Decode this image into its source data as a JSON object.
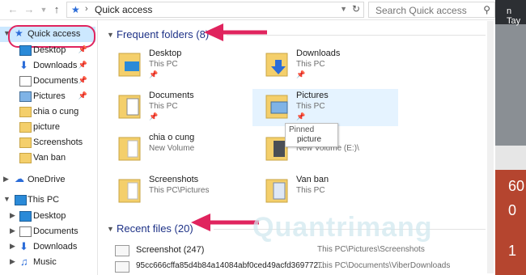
{
  "address": {
    "path": "Quick access",
    "search_placeholder": "Search Quick access"
  },
  "sidebar": {
    "items": [
      {
        "label": "Quick access",
        "icon": "star-icon"
      },
      {
        "label": "Desktop",
        "icon": "desktop-icon",
        "pinned": true
      },
      {
        "label": "Downloads",
        "icon": "download-icon",
        "pinned": true
      },
      {
        "label": "Documents",
        "icon": "documents-icon",
        "pinned": true
      },
      {
        "label": "Pictures",
        "icon": "pictures-icon",
        "pinned": true
      },
      {
        "label": "chia o cung",
        "icon": "folder-icon"
      },
      {
        "label": "picture",
        "icon": "folder-icon"
      },
      {
        "label": "Screenshots",
        "icon": "folder-icon"
      },
      {
        "label": "Van ban",
        "icon": "folder-icon"
      },
      {
        "label": "OneDrive",
        "icon": "cloud-icon"
      },
      {
        "label": "This PC",
        "icon": "computer-icon"
      },
      {
        "label": "Desktop",
        "icon": "desktop-icon"
      },
      {
        "label": "Documents",
        "icon": "documents-icon"
      },
      {
        "label": "Downloads",
        "icon": "download-icon"
      },
      {
        "label": "Music",
        "icon": "music-icon"
      }
    ]
  },
  "frequent": {
    "title": "Frequent folders (8)",
    "folders": [
      {
        "name": "Desktop",
        "path": "This PC",
        "pinned": true
      },
      {
        "name": "Downloads",
        "path": "This PC",
        "pinned": true
      },
      {
        "name": "Documents",
        "path": "This PC",
        "pinned": true
      },
      {
        "name": "Pictures",
        "path": "This PC",
        "pinned": true
      },
      {
        "name": "chia o cung",
        "path": "New Volume"
      },
      {
        "name": "picture",
        "path": "New Volume (E:)\\"
      },
      {
        "name": "Screenshots",
        "path": "This PC\\Pictures"
      },
      {
        "name": "Van ban",
        "path": "This PC"
      }
    ]
  },
  "tooltip": {
    "line1": "Pinned",
    "line2": "picture"
  },
  "recent": {
    "title": "Recent files (20)",
    "files": [
      {
        "name": "Screenshot (247)",
        "path": "This PC\\Pictures\\Screenshots"
      },
      {
        "name": "95cc666cffa85d4b84a14084abf0ced49acfd369772...",
        "path": "This PC\\Documents\\ViberDownloads"
      }
    ]
  },
  "right_strip": {
    "lines": [
      "n Tay",
      "60",
      "0",
      "1"
    ]
  },
  "watermark": "Quantrimang",
  "colors": {
    "accent": "#1e3287",
    "arrow": "#e0245e",
    "selection": "#cce8ff",
    "folder": "#f4cf6b"
  }
}
